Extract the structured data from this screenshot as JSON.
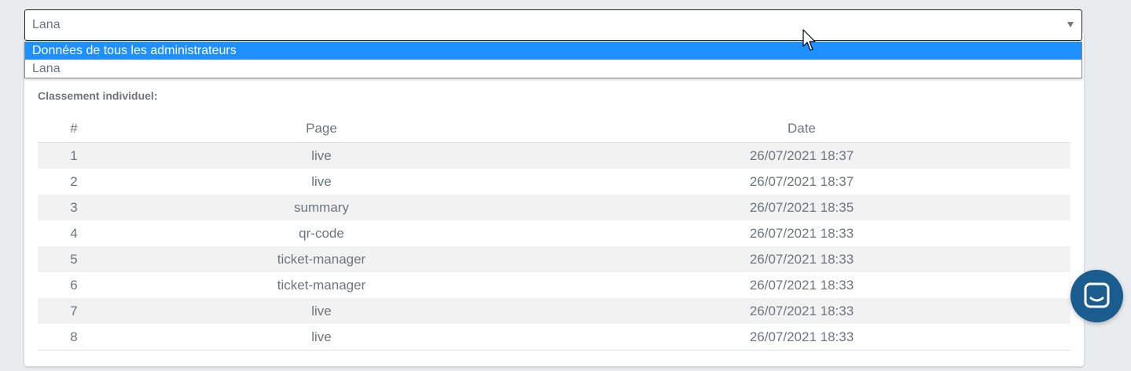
{
  "admin_select": {
    "value": "Lana",
    "options": [
      {
        "label": "Données de tous les administrateurs",
        "selected": true
      },
      {
        "label": "Lana",
        "selected": false
      }
    ]
  },
  "ranking": {
    "title": "Classement individuel:",
    "headers": {
      "num": "#",
      "page": "Page",
      "date": "Date"
    },
    "rows": [
      {
        "num": "1",
        "page": "live",
        "date": "26/07/2021 18:37"
      },
      {
        "num": "2",
        "page": "live",
        "date": "26/07/2021 18:37"
      },
      {
        "num": "3",
        "page": "summary",
        "date": "26/07/2021 18:35"
      },
      {
        "num": "4",
        "page": "qr-code",
        "date": "26/07/2021 18:33"
      },
      {
        "num": "5",
        "page": "ticket-manager",
        "date": "26/07/2021 18:33"
      },
      {
        "num": "6",
        "page": "ticket-manager",
        "date": "26/07/2021 18:33"
      },
      {
        "num": "7",
        "page": "live",
        "date": "26/07/2021 18:33"
      },
      {
        "num": "8",
        "page": "live",
        "date": "26/07/2021 18:33"
      }
    ]
  },
  "chat_widget": {
    "icon": "chat-bubble-icon",
    "color": "#1b5c8e"
  },
  "colors": {
    "highlight": "#1e90ff",
    "text": "#6c757d"
  }
}
